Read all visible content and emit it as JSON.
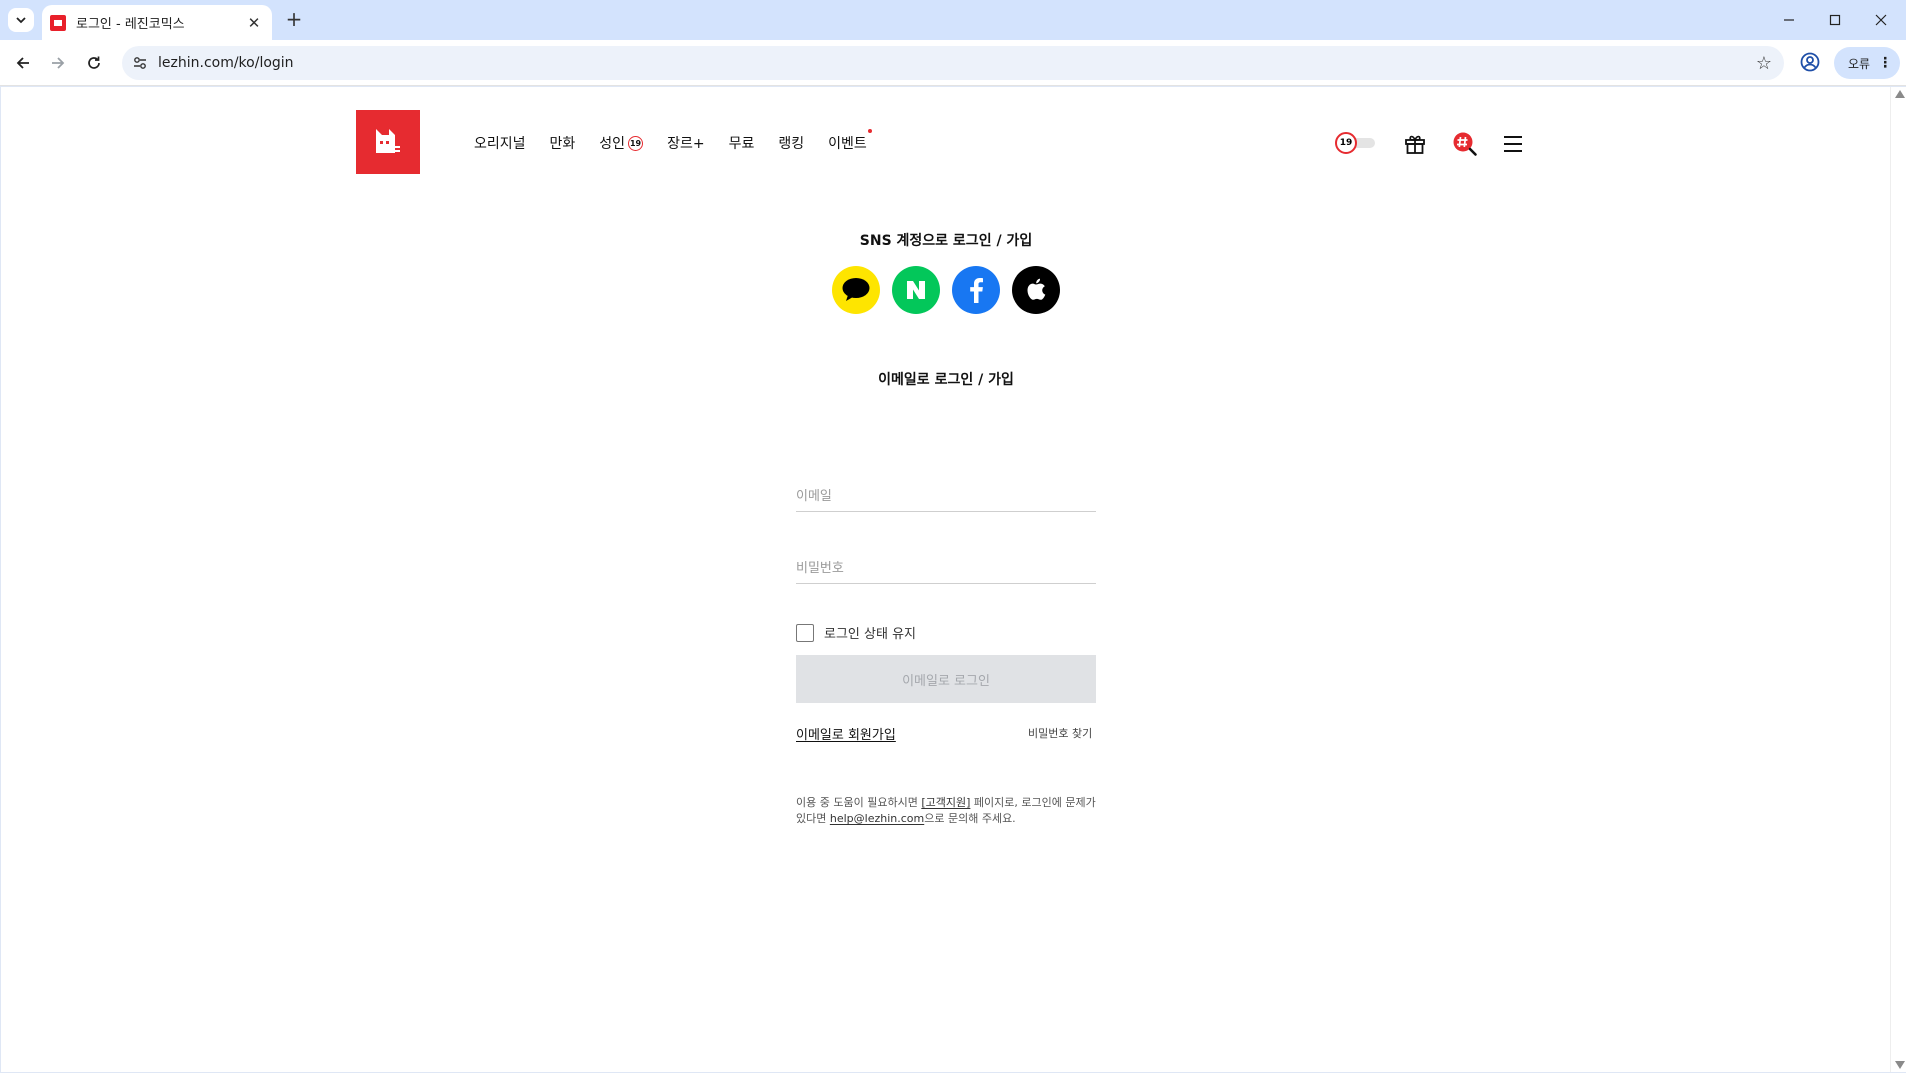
{
  "browser": {
    "tab_title": "로그인 - 레진코믹스",
    "url": "lezhin.com/ko/login",
    "profile_chip_label": "오류"
  },
  "header": {
    "nav": [
      {
        "label": "오리지널"
      },
      {
        "label": "만화"
      },
      {
        "label": "성인",
        "badge": "19"
      },
      {
        "label": "장르+"
      },
      {
        "label": "무료"
      },
      {
        "label": "랭킹"
      },
      {
        "label": "이벤트",
        "new_dot": true
      }
    ],
    "adult_toggle_label": "19"
  },
  "login": {
    "sns_title": "SNS 계정으로 로그인 / 가입",
    "sns_providers": [
      {
        "name": "kakao",
        "color": "#FEE500"
      },
      {
        "name": "naver",
        "color": "#03C75A"
      },
      {
        "name": "facebook",
        "color": "#1877F2"
      },
      {
        "name": "apple",
        "color": "#000000"
      }
    ],
    "email_title": "이메일로 로그인 / 가입",
    "email_placeholder": "이메일",
    "password_placeholder": "비밀번호",
    "keep_login_label": "로그인 상태 유지",
    "email_login_button": "이메일로 로그인",
    "signup_link": "이메일로 회원가입",
    "find_password_link": "비밀번호 찾기",
    "help": {
      "text1": "이용 중 도움이 필요하시면 ",
      "support_link": "[고객지원]",
      "text2": " 페이지로, 로그인에 문제가 있다면 ",
      "email_link": "help@lezhin.com",
      "text3": "으로 문의해 주세요."
    }
  },
  "colors": {
    "brand_red": "#E62B30",
    "button_disabled_bg": "#E0E2E5"
  }
}
